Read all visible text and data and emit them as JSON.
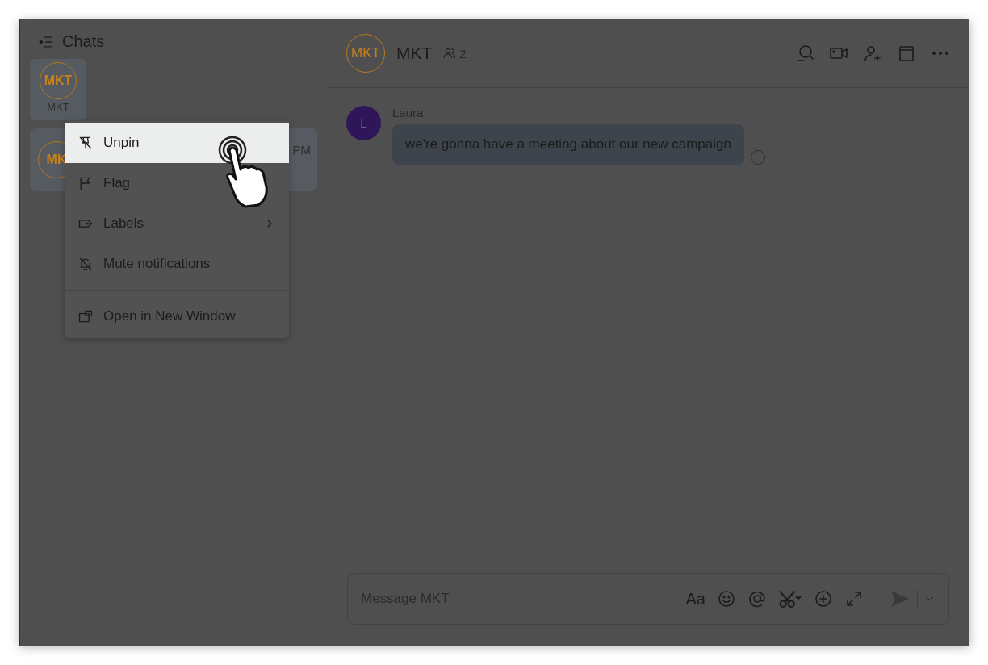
{
  "sidebar": {
    "title": "Chats",
    "pinned": [
      {
        "avatar": "MKT",
        "label": "MKT"
      }
    ],
    "chats": [
      {
        "avatar": "MK",
        "time": "PM"
      }
    ]
  },
  "context_menu": {
    "groups": [
      [
        {
          "label": "Unpin",
          "selected": true,
          "submenu": false
        },
        {
          "label": "Flag",
          "selected": false,
          "submenu": false
        },
        {
          "label": "Labels",
          "selected": false,
          "submenu": true
        },
        {
          "label": "Mute notifications",
          "selected": false,
          "submenu": false
        }
      ],
      [
        {
          "label": "Open in New Window",
          "selected": false,
          "submenu": false
        }
      ]
    ]
  },
  "chat": {
    "avatar": "MKT",
    "title": "MKT",
    "member_count": "2",
    "messages": [
      {
        "avatar": "L",
        "sender": "Laura",
        "text": "we're gonna have a meeting about our new campaign"
      }
    ],
    "composer": {
      "placeholder": "Message MKT",
      "format_label": "Aa"
    }
  }
}
